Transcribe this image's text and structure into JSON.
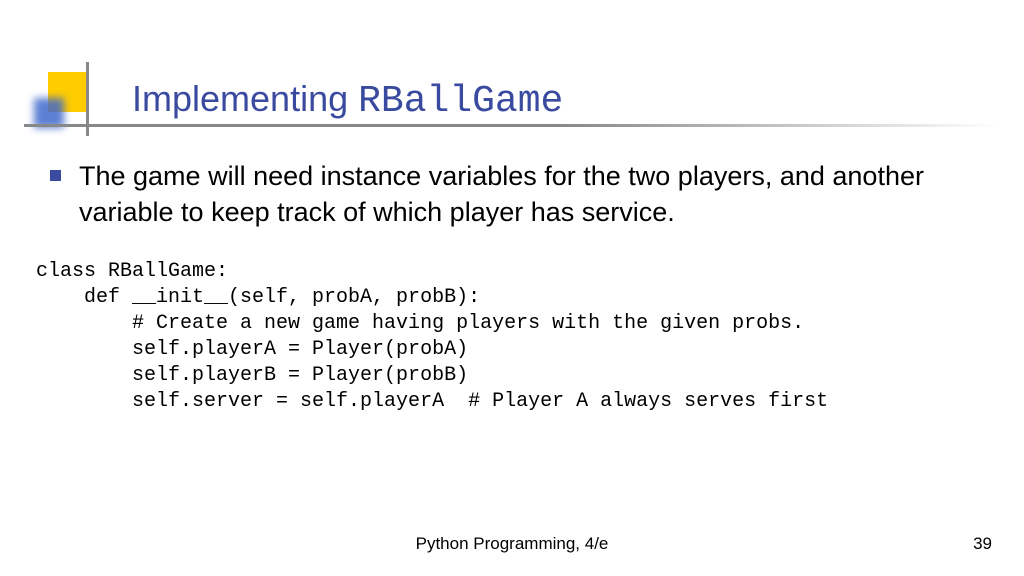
{
  "title": {
    "prefix": "Implementing ",
    "mono": "RBallGame"
  },
  "bullet": "The game will need instance variables for the two players, and another variable to keep track of which player has service.",
  "code": "class RBallGame:\n    def __init__(self, probA, probB):\n        # Create a new game having players with the given probs.\n        self.playerA = Player(probA)\n        self.playerB = Player(probB)\n        self.server = self.playerA  # Player A always serves first",
  "footer": {
    "center": "Python Programming, 4/e",
    "page": "39"
  }
}
